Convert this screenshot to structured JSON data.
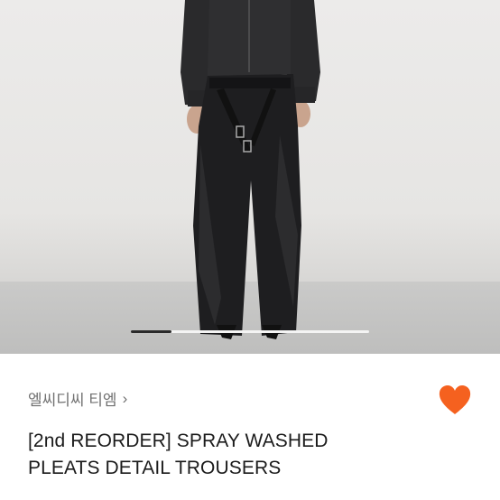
{
  "product": {
    "shop_name": "엘씨디씨 티엠",
    "shop_chevron": "›",
    "title_line1": "[2nd REORDER] SPRAY WASHED",
    "title_line2": "PLEATS DETAIL TROUSERS"
  },
  "image_carousel": {
    "progress": 0.17
  },
  "favorite": {
    "icon": "heart-icon",
    "color": "#f5611f"
  }
}
